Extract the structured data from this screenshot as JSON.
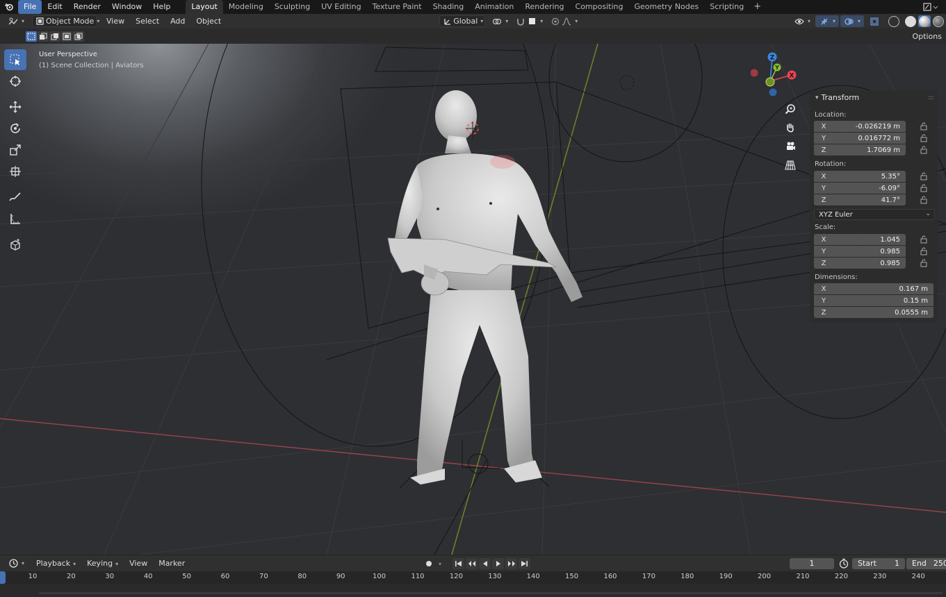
{
  "app": {
    "menus": [
      {
        "label": "File",
        "active": true
      },
      {
        "label": "Edit"
      },
      {
        "label": "Render"
      },
      {
        "label": "Window"
      },
      {
        "label": "Help"
      }
    ],
    "workspace_tabs": [
      {
        "label": "Layout",
        "active": true
      },
      {
        "label": "Modeling"
      },
      {
        "label": "Sculpting"
      },
      {
        "label": "UV Editing"
      },
      {
        "label": "Texture Paint"
      },
      {
        "label": "Shading"
      },
      {
        "label": "Animation"
      },
      {
        "label": "Rendering"
      },
      {
        "label": "Compositing"
      },
      {
        "label": "Geometry Nodes"
      },
      {
        "label": "Scripting"
      }
    ],
    "add_workspace": "+"
  },
  "viewport_header": {
    "mode": "Object Mode",
    "menus": [
      "View",
      "Select",
      "Add",
      "Object"
    ],
    "orientation": "Global"
  },
  "tool_settings": {
    "options_label": "Options"
  },
  "viewport": {
    "perspective": "User Perspective",
    "collection": "(1) Scene Collection | Aviators",
    "gizmo_axes": [
      "X",
      "Y",
      "Z"
    ],
    "axis_colors": {
      "x": "#e84555",
      "y": "#8bbd32",
      "z": "#3c87e0"
    }
  },
  "transform_panel": {
    "title": "Transform",
    "location": {
      "label": "Location:",
      "rows": [
        {
          "axis": "X",
          "value": "-0.026219 m"
        },
        {
          "axis": "Y",
          "value": "0.016772 m"
        },
        {
          "axis": "Z",
          "value": "1.7069 m"
        }
      ]
    },
    "rotation": {
      "label": "Rotation:",
      "rows": [
        {
          "axis": "X",
          "value": "5.35°"
        },
        {
          "axis": "Y",
          "value": "-6.09°"
        },
        {
          "axis": "Z",
          "value": "41.7°"
        }
      ],
      "mode": "XYZ Euler"
    },
    "scale": {
      "label": "Scale:",
      "rows": [
        {
          "axis": "X",
          "value": "1.045"
        },
        {
          "axis": "Y",
          "value": "0.985"
        },
        {
          "axis": "Z",
          "value": "0.985"
        }
      ]
    },
    "dimensions": {
      "label": "Dimensions:",
      "rows": [
        {
          "axis": "X",
          "value": "0.167 m"
        },
        {
          "axis": "Y",
          "value": "0.15 m"
        },
        {
          "axis": "Z",
          "value": "0.0555 m"
        }
      ]
    }
  },
  "timeline": {
    "menus": [
      "Playback",
      "Keying",
      "View",
      "Marker"
    ],
    "current_frame": "1",
    "start_label": "Start",
    "start_value": "1",
    "end_label": "End",
    "end_value": "250",
    "ruler_ticks": [
      "10",
      "20",
      "30",
      "40",
      "50",
      "60",
      "70",
      "80",
      "90",
      "100",
      "110",
      "120",
      "130",
      "140",
      "150",
      "160",
      "170",
      "180",
      "190",
      "200",
      "210",
      "220",
      "230",
      "240"
    ]
  },
  "colors": {
    "accent": "#4772b3",
    "panel_bg": "#303030",
    "field_bg": "#545454"
  }
}
